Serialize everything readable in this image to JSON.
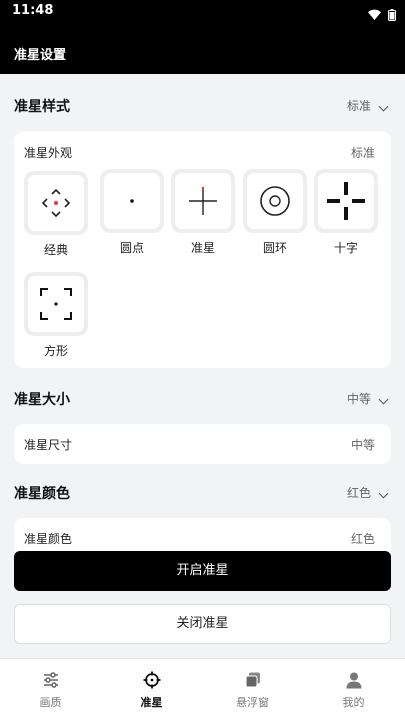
{
  "status": {
    "time": "11:48"
  },
  "appbar": {
    "title": "准星设置"
  },
  "style_section": {
    "title": "准星样式",
    "value": "标准",
    "card": {
      "label": "准星外观",
      "value": "标准",
      "options": [
        {
          "label": "经典",
          "icon": "classic-crosshair-icon"
        },
        {
          "label": "圆点",
          "icon": "dot-crosshair-icon"
        },
        {
          "label": "准星",
          "icon": "cross-crosshair-icon"
        },
        {
          "label": "圆环",
          "icon": "ring-crosshair-icon"
        },
        {
          "label": "十字",
          "icon": "plus-crosshair-icon"
        },
        {
          "label": "方形",
          "icon": "square-crosshair-icon"
        }
      ]
    }
  },
  "size_section": {
    "title": "准星大小",
    "value": "中等",
    "card": {
      "label": "准星尺寸",
      "value": "中等"
    }
  },
  "color_section": {
    "title": "准星颜色",
    "value": "红色",
    "card": {
      "label": "准星颜色",
      "value": "红色"
    }
  },
  "buttons": {
    "open": "开启准星",
    "close": "关闭准星"
  },
  "nav": {
    "items": [
      {
        "label": "画质",
        "icon": "sliders-icon"
      },
      {
        "label": "准星",
        "icon": "crosshair-icon",
        "active": true
      },
      {
        "label": "悬浮窗",
        "icon": "floating-window-icon"
      },
      {
        "label": "我的",
        "icon": "person-icon"
      }
    ]
  },
  "colors": {
    "accent": "#e53935",
    "dark": "#000000"
  }
}
